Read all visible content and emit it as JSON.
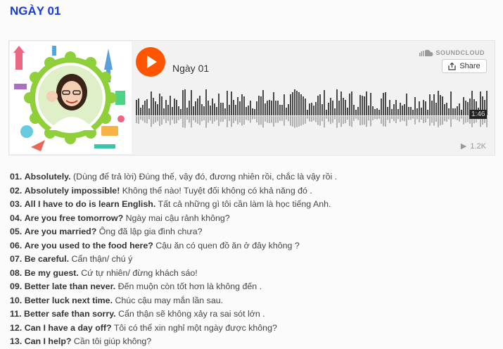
{
  "page": {
    "title": "NGÀY 01"
  },
  "player": {
    "track_title": "Ngày 01",
    "brand": "SOUNDCLOUD",
    "share_label": "Share",
    "duration": "1:46",
    "plays": "1.2K",
    "accent_color": "#ff5500"
  },
  "phrases": [
    {
      "num": "01.",
      "en": "Absolutely.",
      "vi": "(Dùng để trả lời) Đúng thế, vậy đó, đương nhiên rồi, chắc là vậy rồi ."
    },
    {
      "num": "02.",
      "en": "Absolutely impossible!",
      "vi": "Không thể nào! Tuyệt đối không có khả năng đó ."
    },
    {
      "num": "03.",
      "en": "All I have to do is learn English.",
      "vi": "Tất cả những gì tôi cần làm là học tiếng Anh."
    },
    {
      "num": "04.",
      "en": "Are you free tomorrow?",
      "vi": "Ngày mai cậu rảnh không?"
    },
    {
      "num": "05.",
      "en": "Are you married?",
      "vi": "Ông đã lập gia đình chưa?"
    },
    {
      "num": "06.",
      "en": "Are you used to the food here?",
      "vi": "Cậu ăn có quen đồ ăn ở đây không ?"
    },
    {
      "num": "07.",
      "en": "Be careful.",
      "vi": "Cẩn thận/ chú ý"
    },
    {
      "num": "08.",
      "en": "Be my guest.",
      "vi": "Cứ tự nhiên/ đừng khách sáo!"
    },
    {
      "num": "09.",
      "en": "Better late than never.",
      "vi": "Đến muộn còn tốt hơn là không đến ."
    },
    {
      "num": "10.",
      "en": "Better luck next time.",
      "vi": "Chúc cậu may mắn lần sau."
    },
    {
      "num": "11.",
      "en": "Better safe than sorry.",
      "vi": "Cẩn thận sẽ không xảy ra sai sót lớn ."
    },
    {
      "num": "12.",
      "en": "Can I have a day off?",
      "vi": "Tôi có thể xin nghỉ một ngày được không?"
    },
    {
      "num": "13.",
      "en": "Can I help?",
      "vi": "Cần tôi giúp không?"
    }
  ]
}
